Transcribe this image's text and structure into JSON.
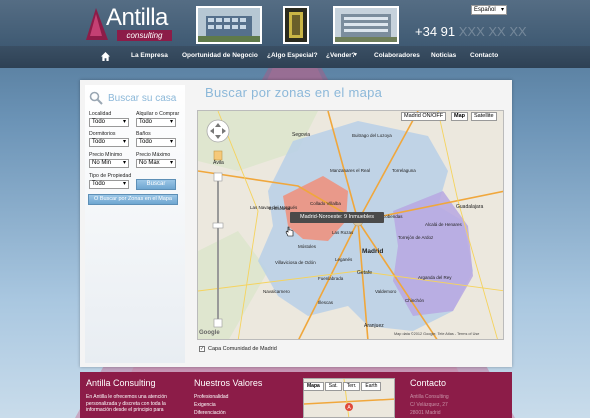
{
  "header": {
    "logo_text": "Antilla",
    "logo_sub": "consulting",
    "phone_visible": "+34 91",
    "phone_hidden": "XXX XX XX",
    "language": "Español"
  },
  "nav": {
    "items": [
      "La Empresa",
      "Oportunidad de Negocio",
      "¿Algo Especial?",
      "¿Vender?",
      "Colaboradores",
      "Noticias",
      "Contacto"
    ]
  },
  "search": {
    "title": "Buscar su casa",
    "localidad_label": "Localidad",
    "localidad_value": "Todo",
    "alquilar_label": "Alquilar o Comprar",
    "alquilar_value": "Todo",
    "dormitorios_label": "Dormitorios",
    "dormitorios_value": "Todo",
    "banos_label": "Baños",
    "banos_value": "Todo",
    "precio_min_label": "Precio Mínimo",
    "precio_min_value": "No Min",
    "precio_max_label": "Precio Máximo",
    "precio_max_value": "No Max",
    "tipo_label": "Tipo de Propiedad",
    "tipo_value": "Todo",
    "buscar_button": "Buscar",
    "zonas_button": "O Buscar por Zonas en el Mapa"
  },
  "map": {
    "title": "Buscar por zonas en el mapa",
    "madrid_toggle": "Madrid ON/OFF",
    "map_tab": "Map",
    "satellite_tab": "Satellite",
    "tooltip": "Madrid-Noroeste: 9 Inmuebles",
    "checkbox_label": "Capa Comunidad de Madrid",
    "copyright": "Map data ©2012 Google, Tele Atlas - Terms of Use",
    "places": [
      "Segovia",
      "Buitrago del Lozoya",
      "Torrelaguna",
      "Manzanares el Real",
      "Collado Villalba",
      "El Escorial",
      "Las Rozas",
      "Alcobendas",
      "Guadalajara",
      "Madrid",
      "Torrejón de Ardoz",
      "Alcalá de Henares",
      "Leganés",
      "Getafe",
      "Fuenlabrada",
      "Móstoles",
      "Villaviciosa de Odón",
      "Aranjuez",
      "Ávila",
      "Las Navas del Marqués",
      "Arganda del Rey",
      "Chinchón",
      "Illescas",
      "Valdemoro",
      "Navalcarnero"
    ]
  },
  "footer": {
    "col1_title": "Antilla Consulting",
    "col1_text": "En Antilla le ofrecemos una atención personalizada y discreta con toda la información desde el principio para",
    "col2_title": "Nuestros Valores",
    "col2_items": [
      "Profesionalidad",
      "Exigencia",
      "Diferenciación"
    ],
    "mini_map_tabs": [
      "Mapa",
      "Sat.",
      "Terr.",
      "Earth"
    ],
    "col4_title": "Contacto",
    "col4_lines": [
      "Antilla Consulting",
      "C/ Velázquez, 27",
      "28001 Madrid"
    ]
  },
  "colors": {
    "brand": "#8c1c48",
    "accent": "#8cb8d9",
    "nav_bg": "#3a4f64"
  }
}
